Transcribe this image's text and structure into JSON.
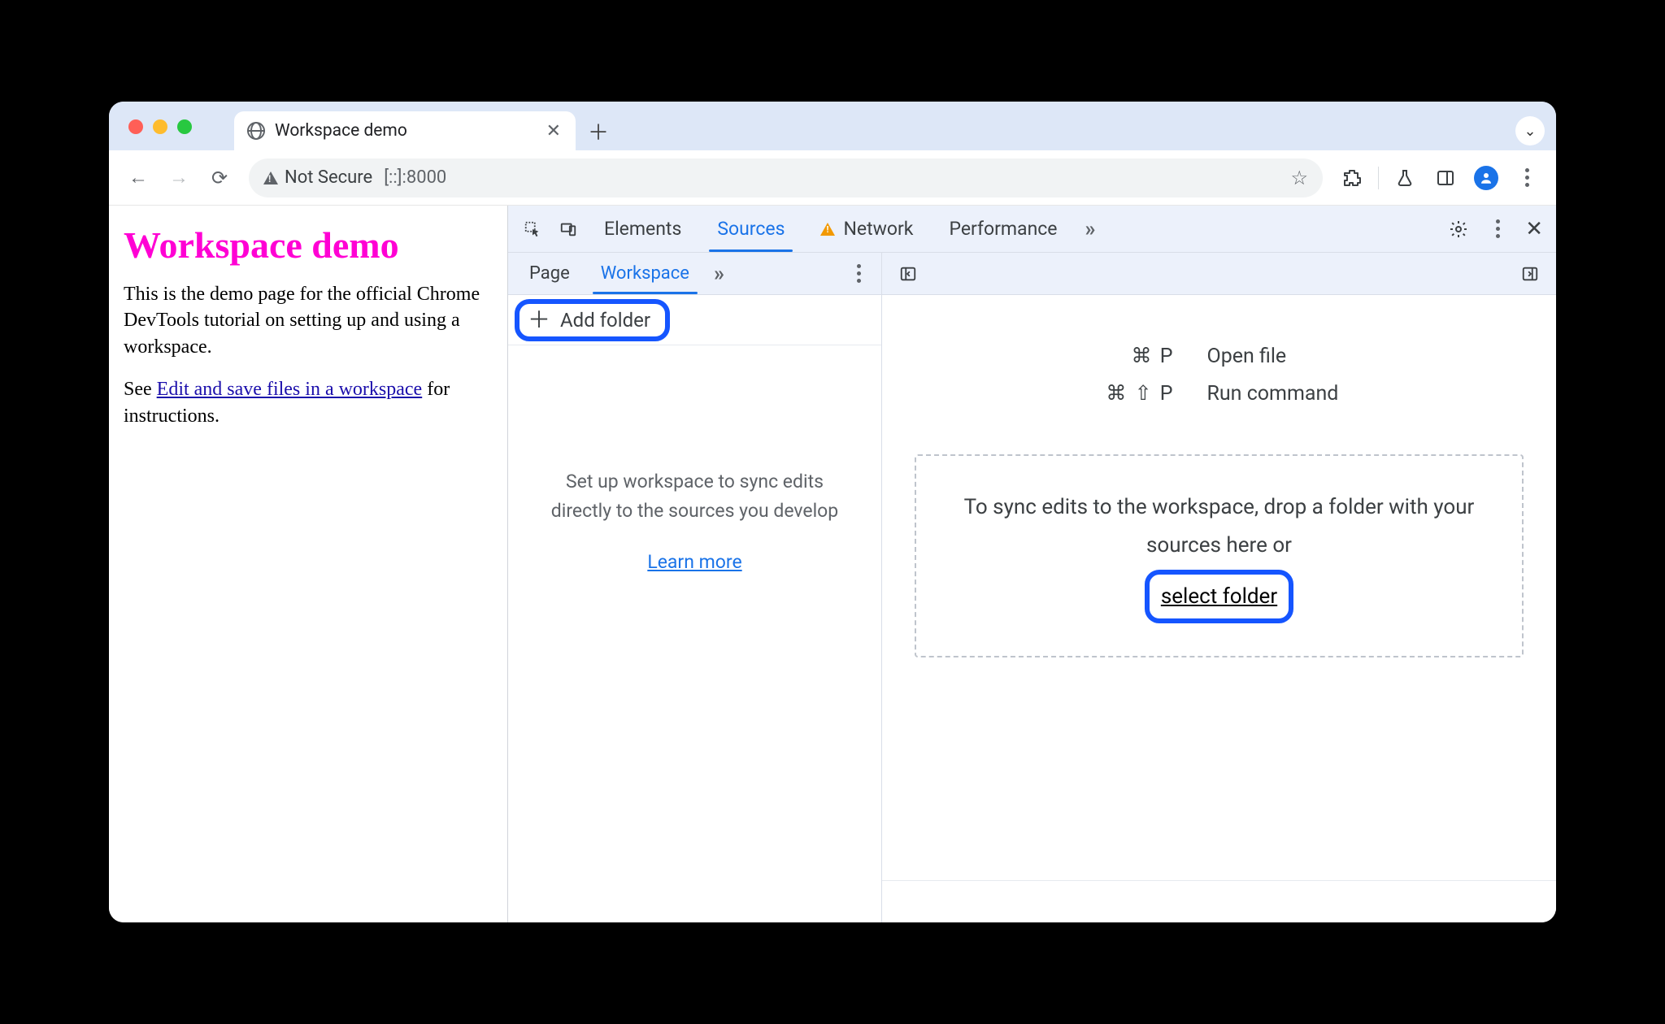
{
  "browser": {
    "tab_title": "Workspace demo",
    "security_label": "Not Secure",
    "address": "[::]:8000"
  },
  "page": {
    "heading": "Workspace demo",
    "para1": "This is the demo page for the official Chrome DevTools tutorial on setting up and using a workspace.",
    "para2_pre": "See ",
    "para2_link": "Edit and save files in a workspace",
    "para2_post": " for instructions."
  },
  "devtools": {
    "tabs": {
      "elements": "Elements",
      "sources": "Sources",
      "network": "Network",
      "performance": "Performance"
    },
    "nav": {
      "page_tab": "Page",
      "workspace_tab": "Workspace",
      "add_folder": "Add folder",
      "helper_text": "Set up workspace to sync edits directly to the sources you develop",
      "learn_more": "Learn more"
    },
    "editor": {
      "open_file_keys": "⌘ P",
      "open_file_label": "Open file",
      "run_cmd_keys": "⌘ ⇧ P",
      "run_cmd_label": "Run command",
      "drop_text": "To sync edits to the workspace, drop a folder with your sources here or",
      "select_folder": "select folder"
    }
  }
}
